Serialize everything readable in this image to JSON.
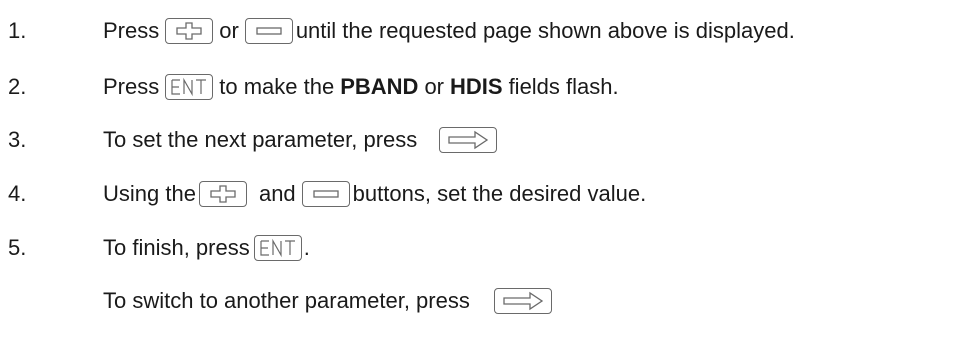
{
  "steps": [
    {
      "number": "1.",
      "text_press": "Press",
      "text_or": "or",
      "text_rest": "until the requested page shown above is displayed."
    },
    {
      "number": "2.",
      "text_press": "Press",
      "text_mid": "to make the",
      "field1": "PBAND",
      "text_or": "or",
      "field2": "HDIS",
      "text_end": "fields flash."
    },
    {
      "number": "3.",
      "text": "To set the next parameter, press"
    },
    {
      "number": "4.",
      "text_using": "Using the",
      "text_and": "and",
      "text_rest": "buttons, set the desired value."
    },
    {
      "number": "5.",
      "text": "To finish, press",
      "text_period": "."
    },
    {
      "number": "",
      "text": "To switch to another parameter, press"
    }
  ],
  "icons": {
    "plus": "plus-key-icon",
    "minus": "minus-key-icon",
    "enter": "enter-key-icon",
    "right_arrow": "right-arrow-key-icon"
  },
  "colors": {
    "text": "#1a1a1a",
    "key_border": "#6a6a6a"
  }
}
